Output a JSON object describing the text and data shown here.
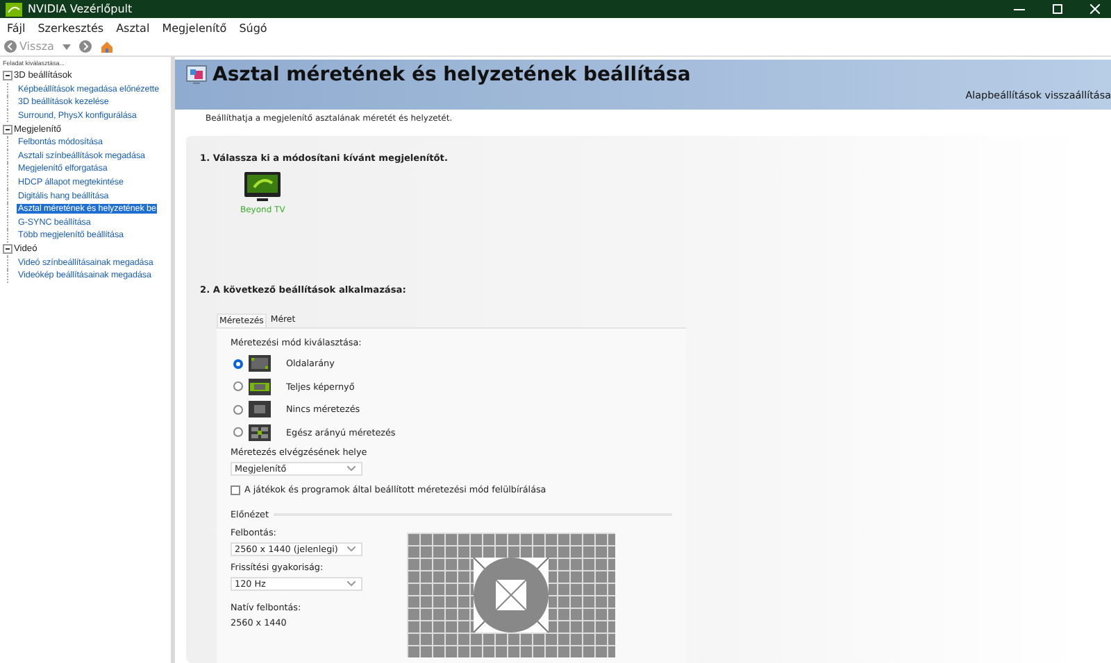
{
  "window": {
    "title": "NVIDIA Vezérlőpult"
  },
  "menu": [
    "Fájl",
    "Szerkesztés",
    "Asztal",
    "Megjelenítő",
    "Súgó"
  ],
  "toolbar": {
    "back": "Vissza"
  },
  "sidebar": {
    "header": "Feladat kiválasztása...",
    "tree": [
      {
        "label": "3D beállítások",
        "expanded": true,
        "children": [
          {
            "label": "Képbeállítások megadása előnézette",
            "selected": false
          },
          {
            "label": "3D beállítások kezelése",
            "selected": false
          },
          {
            "label": "Surround, PhysX konfigurálása",
            "selected": false
          }
        ]
      },
      {
        "label": "Megjelenítő",
        "expanded": true,
        "children": [
          {
            "label": "Felbontás módosítása",
            "selected": false
          },
          {
            "label": "Asztali színbeállítások megadása",
            "selected": false
          },
          {
            "label": "Megjelenítő elforgatása",
            "selected": false
          },
          {
            "label": "HDCP állapot megtekintése",
            "selected": false
          },
          {
            "label": "Digitális hang beállítása",
            "selected": false
          },
          {
            "label": "Asztal méretének és helyzetének be",
            "selected": true
          },
          {
            "label": "G-SYNC beállítása",
            "selected": false
          },
          {
            "label": "Több megjelenítő beállítása",
            "selected": false
          }
        ]
      },
      {
        "label": "Videó",
        "expanded": true,
        "children": [
          {
            "label": "Videó színbeállításainak megadása",
            "selected": false
          },
          {
            "label": "Videókép beállításainak megadása",
            "selected": false
          }
        ]
      }
    ]
  },
  "page": {
    "title": "Asztal méretének és helyzetének beállítása",
    "restore": "Alapbeállítások visszaállítása",
    "description": "Beállíthatja a megjelenítő asztalának méretét és helyzetét.",
    "step1": "1. Válassza ki a módosítani kívánt megjelenítőt.",
    "displays": [
      {
        "name": "Beyond TV",
        "selected": true
      }
    ],
    "step2": "2. A következő beállítások alkalmazása:",
    "tabs": [
      {
        "label": "Méretezés",
        "selected": true
      },
      {
        "label": "Méret",
        "selected": false
      }
    ],
    "mode_label": "Méretezési mód kiválasztása:",
    "modes": [
      {
        "label": "Oldalarány",
        "kind": "aspect",
        "selected": true
      },
      {
        "label": "Teljes képernyő",
        "kind": "full",
        "selected": false
      },
      {
        "label": "Nincs méretezés",
        "kind": "none",
        "selected": false
      },
      {
        "label": "Egész arányú méretezés",
        "kind": "integer",
        "selected": false
      }
    ],
    "where_label": "Méretezés elvégzésének helye",
    "where_value": "Megjelenítő",
    "override": {
      "label": "A játékok és programok által beállított méretezési mód felülbírálása",
      "checked": false
    },
    "preview": "Előnézet",
    "resolution_label": "Felbontás:",
    "resolution_value": "2560 x 1440 (jelenlegi)",
    "refresh_label": "Frissítési gyakoriság:",
    "refresh_value": "120 Hz",
    "native_label": "Natív felbontás:",
    "native_value": "2560 x 1440"
  }
}
